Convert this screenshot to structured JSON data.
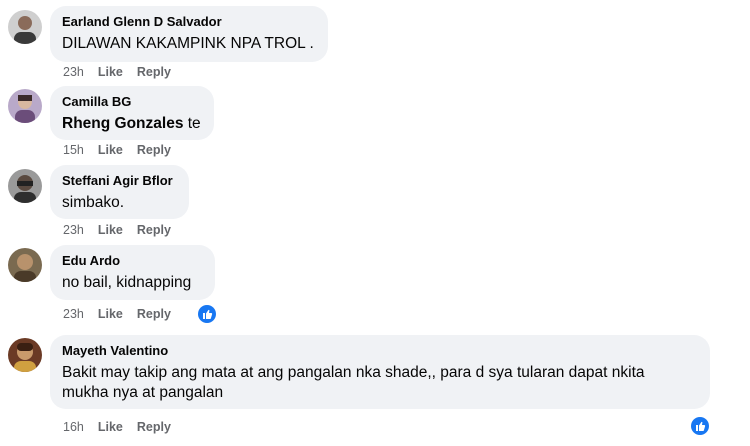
{
  "comments": [
    {
      "author": "Earland Glenn D Salvador",
      "text": "DILAWAN KAKAMPINK NPA TROL .",
      "time": "23h",
      "like": "Like",
      "reply": "Reply"
    },
    {
      "author": "Camilla BG",
      "mention": "Rheng Gonzales",
      "text": " te",
      "time": "15h",
      "like": "Like",
      "reply": "Reply"
    },
    {
      "author": "Steffani Agir Bflor",
      "text": "simbako.",
      "time": "23h",
      "like": "Like",
      "reply": "Reply"
    },
    {
      "author": "Edu Ardo",
      "text": "no bail, kidnapping",
      "time": "23h",
      "like": "Like",
      "reply": "Reply",
      "reaction": "like-reaction-icon"
    },
    {
      "author": "Mayeth Valentino",
      "text_line1": "Bakit may takip ang mata at ang pangalan nka shade,, para d sya tularan dapat nkita",
      "text_line2": "mukha nya at pangalan",
      "time": "16h",
      "like": "Like",
      "reply": "Reply",
      "reaction": "like-reaction-icon"
    }
  ],
  "colors": {
    "bubble": "#f0f2f5",
    "meta": "#65676b",
    "accent": "#1877f2"
  }
}
